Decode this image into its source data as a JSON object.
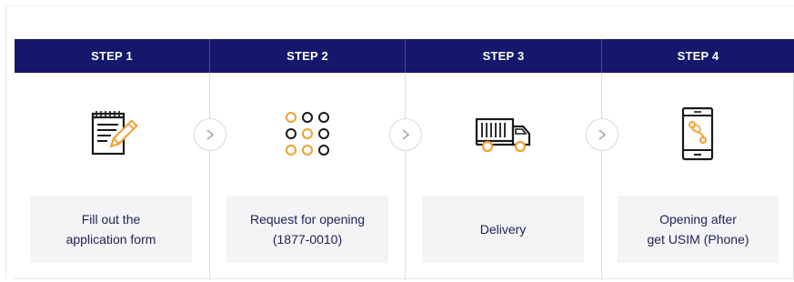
{
  "steps": [
    {
      "header": "STEP 1",
      "icon": "form-pencil-icon",
      "label": "Fill out the\napplication form"
    },
    {
      "header": "STEP 2",
      "icon": "keypad-dots-icon",
      "label": "Request for opening\n(1877-0010)"
    },
    {
      "header": "STEP 3",
      "icon": "delivery-truck-icon",
      "label": "Delivery"
    },
    {
      "header": "STEP 4",
      "icon": "smartphone-route-icon",
      "label": "Opening after\nget USIM (Phone)"
    }
  ],
  "colors": {
    "header_bg": "#14176b",
    "accent_orange": "#f0a030",
    "label_text": "#20225a",
    "label_bg": "#f4f4f6"
  }
}
